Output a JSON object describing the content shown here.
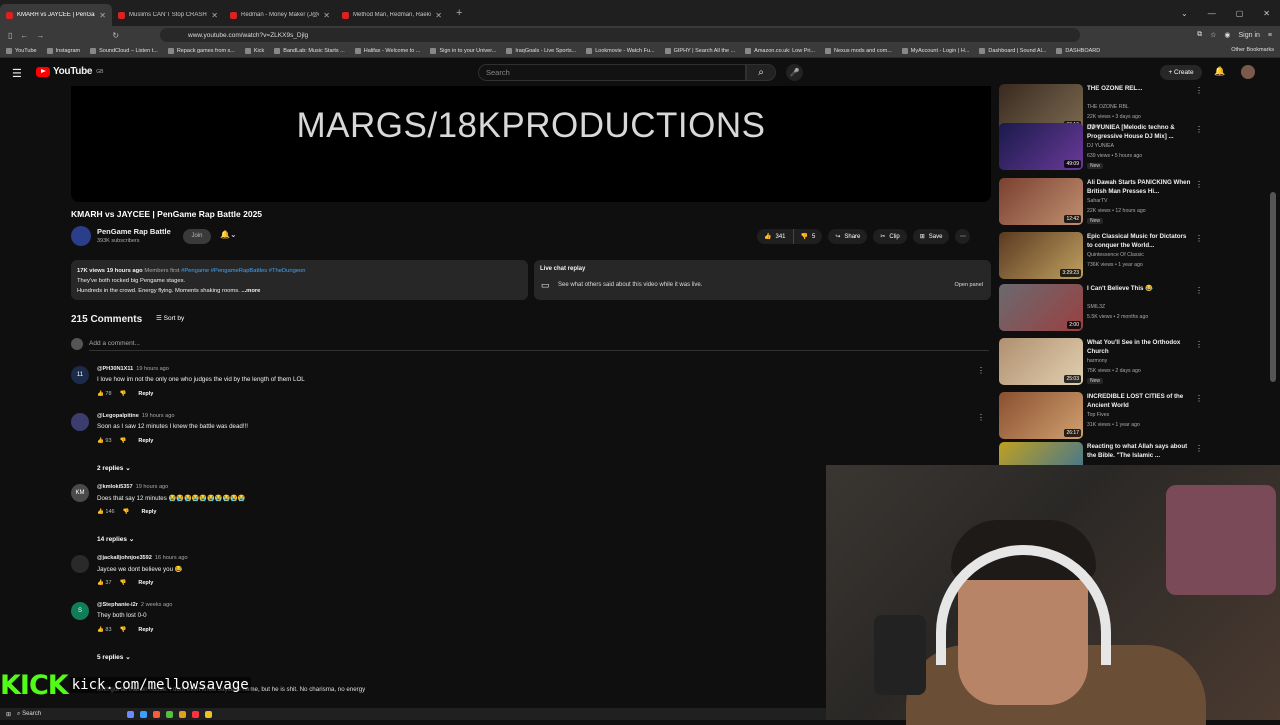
{
  "browser": {
    "tabs": [
      {
        "title": "KMARH vs JAYCEE | PenGame R",
        "active": true
      },
      {
        "title": "Muslims CAN'T Stop CRASHIN",
        "active": false
      },
      {
        "title": "Redman - Money Maker (J@q !",
        "active": false
      },
      {
        "title": "Method Man, Redman, Raekwo",
        "active": false
      }
    ],
    "new_tab": "+",
    "url": "www.youtube.com/watch?v=ZLKX9s_Djlg",
    "signin": "Sign in",
    "bookmarks": [
      "YouTube",
      "Instagram",
      "SoundCloud – Listen t...",
      "Repack games from s...",
      "Kick",
      "BandLab: Music Starts ...",
      "Halifax - Welcome to ...",
      "Sign in to your Univer...",
      "IraqGoals - Live Sports...",
      "Lookmovie - Watch Fu...",
      "GIPHY | Search All the ...",
      "Amazon.co.uk: Low Pri...",
      "Nexus mods and com...",
      "MyAccount - Login | H...",
      "Dashboard | Sound Al...",
      "DASHBOARD"
    ],
    "other_bookmarks": "Other Bookmarks"
  },
  "youtube": {
    "logo": "YouTube",
    "logo_region": "GB",
    "search_placeholder": "Search",
    "create": "Create"
  },
  "video": {
    "player_text": "MARGS/18KPRODUCTIONS",
    "title": "KMARH vs JAYCEE | PenGame Rap Battle 2025",
    "channel": "PenGame Rap Battle",
    "subscribers": "393K subscribers",
    "join": "Join",
    "likes": "341",
    "dislikes": "5",
    "share": "Share",
    "clip": "Clip",
    "save": "Save"
  },
  "description": {
    "stats": "17K views  19 hours ago",
    "members": "Members first",
    "tags": "#Pengame #PengameRapBattles #TheDungeon",
    "line1": "They've both rocked big Pengame stages.",
    "line2": "Hundreds in the crowd. Energy flying. Moments shaking rooms.",
    "more": "...more"
  },
  "live_chat": {
    "title": "Live chat replay",
    "subtitle": "See what others said about this video while it was live.",
    "open": "Open panel"
  },
  "comments": {
    "count": "215 Comments",
    "sort": "Sort by",
    "add_placeholder": "Add a comment...",
    "reply_label": "Reply",
    "items": [
      {
        "handle": "@PH30N1X11",
        "time": "19 hours ago",
        "text": "I love how im not the only one who judges the vid by the length of them LOL",
        "likes": "78",
        "avatar": "11",
        "color": "#1d2b4a"
      },
      {
        "handle": "@Legopalpitine",
        "time": "19 hours ago",
        "text": "Soon as I saw 12 minutes I knew the battle was dead!!!",
        "likes": "93",
        "avatar": "",
        "color": "#3a3d6e"
      },
      {
        "handle": "@kmloki5357",
        "time": "19 hours ago",
        "text": "Does that say 12 minutes 😭😭😭😭😭😭😭😭😭😭",
        "likes": "146",
        "avatar": "KM",
        "color": "#4a4a4a"
      },
      {
        "handle": "@jackalljohnjoe3592",
        "time": "16 hours ago",
        "text": "Jaycee we dont believe you 😂",
        "likes": "37",
        "avatar": "",
        "color": "#2a2a2a"
      },
      {
        "handle": "@Stephanie-i2r",
        "time": "2 weeks ago",
        "text": "They both lost 0-0",
        "likes": "83",
        "avatar": "S",
        "color": "#0f7d5a"
      }
    ],
    "replies": [
      "2 replies",
      "14 replies",
      "5 replies"
    ],
    "partial_text": "kmh got all that on house. I dont even know Jaycees name, but he is shit. No charisma, no energy"
  },
  "sidebar": [
    {
      "title": "THE OZONE REL...",
      "channel": "THE OZONE RBL",
      "meta": "22K views • 3 days ago",
      "new": "New",
      "duration": "32:16",
      "c1": "#3a2a20",
      "c2": "#7a6a50"
    },
    {
      "title": "DJ YUNIEA [Melodic techno & Progressive House DJ Mix] ...",
      "channel": "DJ YUNIEA",
      "meta": "639 views • 5 hours ago",
      "new": "New",
      "duration": "49:09",
      "c1": "#1a1a4a",
      "c2": "#6a3a9a"
    },
    {
      "title": "Ali Dawah Starts PANICKING When British Man Presses Hi...",
      "channel": "SaharTV",
      "meta": "22K views • 12 hours ago",
      "new": "New",
      "duration": "12:42",
      "c1": "#7a4030",
      "c2": "#c09070"
    },
    {
      "title": "Epic Classical Music for Dictators to conquer the World...",
      "channel": "Quintessence Of Classic",
      "meta": "736K views • 1 year ago",
      "new": "",
      "duration": "3:29:23",
      "c1": "#5a3a20",
      "c2": "#c0a060"
    },
    {
      "title": "I Can't Believe This 😂",
      "channel": "SMIL3Z",
      "meta": "5.5K views • 2 months ago",
      "new": "",
      "duration": "2:00",
      "c1": "#6a6a70",
      "c2": "#9a4040"
    },
    {
      "title": "What You'll See in the Orthodox Church",
      "channel": "harmony",
      "meta": "75K views • 2 days ago",
      "new": "New",
      "duration": "25:03",
      "c1": "#b09070",
      "c2": "#e0d0b0"
    },
    {
      "title": "INCREDIBLE LOST CITIES of the Ancient World",
      "channel": "Top Fives",
      "meta": "31K views • 1 year ago",
      "new": "",
      "duration": "26:17",
      "c1": "#8a5030",
      "c2": "#d0a070"
    },
    {
      "title": "Reacting to what Allah says about the Bible. \"The Islamic ...",
      "channel": "",
      "meta": "",
      "new": "",
      "duration": "",
      "c1": "#c0a020",
      "c2": "#3070a0"
    }
  ],
  "overlay": {
    "kick_logo": "KICK",
    "kick_url": "kick.com/mellowsavage"
  },
  "taskbar": {
    "search": "Search"
  },
  "colors": {
    "accent_red": "#ff0000",
    "link_blue": "#3ea6ff",
    "kick_green": "#53fc18"
  }
}
